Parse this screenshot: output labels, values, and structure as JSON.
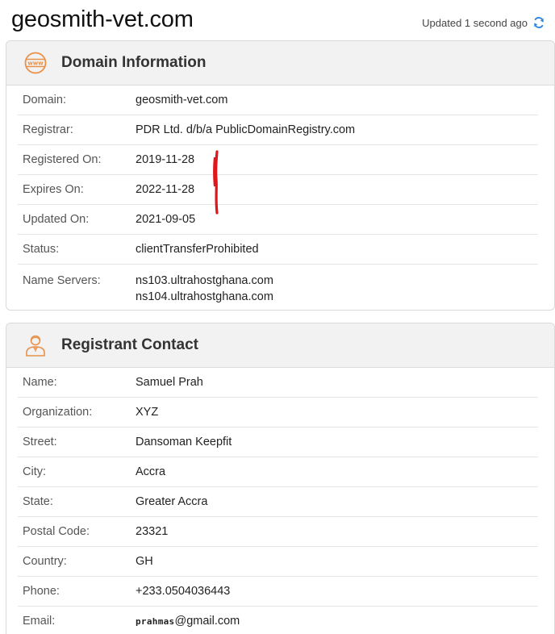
{
  "header": {
    "site_title": "geosmith-vet.com",
    "updated_text": "Updated 1 second ago"
  },
  "domain_info": {
    "title": "Domain Information",
    "icon": "www-globe-icon",
    "rows": [
      {
        "label": "Domain:",
        "value": "geosmith-vet.com"
      },
      {
        "label": "Registrar:",
        "value": "PDR Ltd. d/b/a PublicDomainRegistry.com"
      },
      {
        "label": "Registered On:",
        "value": "2019-11-28"
      },
      {
        "label": "Expires On:",
        "value": "2022-11-28"
      },
      {
        "label": "Updated On:",
        "value": "2021-09-05"
      },
      {
        "label": "Status:",
        "value": "clientTransferProhibited"
      }
    ],
    "name_servers": {
      "label": "Name Servers:",
      "values": [
        "ns103.ultrahostghana.com",
        "ns104.ultrahostghana.com"
      ]
    }
  },
  "registrant": {
    "title": "Registrant Contact",
    "icon": "person-icon",
    "rows": [
      {
        "label": "Name:",
        "value": "Samuel Prah"
      },
      {
        "label": "Organization:",
        "value": "XYZ"
      },
      {
        "label": "Street:",
        "value": "Dansoman Keepfit"
      },
      {
        "label": "City:",
        "value": "Accra"
      },
      {
        "label": "State:",
        "value": "Greater Accra"
      },
      {
        "label": "Postal Code:",
        "value": "23321"
      },
      {
        "label": "Country:",
        "value": "GH"
      },
      {
        "label": "Phone:",
        "value": "+233.0504036443"
      }
    ],
    "email": {
      "label": "Email:",
      "user": "prahmas",
      "domain": "@gmail.com"
    }
  },
  "colors": {
    "accent_orange": "#e8914a",
    "refresh_blue": "#2e86de",
    "annotation_red": "#e0161b"
  }
}
